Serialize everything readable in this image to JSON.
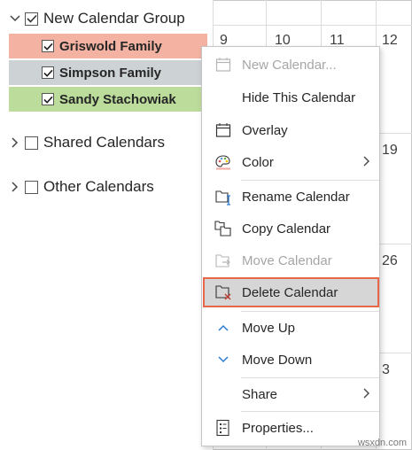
{
  "nav": {
    "group": {
      "label": "New Calendar Group"
    },
    "calendars": [
      {
        "label": "Griswold Family",
        "color": "#f4b3a2"
      },
      {
        "label": "Simpson Family",
        "color": "#cdd2d5"
      },
      {
        "label": "Sandy Stachowiak",
        "color": "#bcdc9c"
      }
    ],
    "shared": {
      "label": "Shared Calendars"
    },
    "other": {
      "label": "Other Calendars"
    }
  },
  "grid": {
    "days": [
      "9",
      "10",
      "11",
      "12",
      "19",
      "26",
      "3"
    ]
  },
  "menu": {
    "items": [
      {
        "label": "New Calendar...",
        "icon": "calendar-icon",
        "disabled": true
      },
      {
        "label": "Hide This Calendar",
        "icon": "",
        "disabled": false
      },
      {
        "label": "Overlay",
        "icon": "overlay-icon",
        "disabled": false
      },
      {
        "label": "Color",
        "icon": "palette-icon",
        "disabled": false,
        "submenu": true
      },
      {
        "label": "Rename Calendar",
        "icon": "rename-icon",
        "disabled": false
      },
      {
        "label": "Copy Calendar",
        "icon": "copy-icon",
        "disabled": false
      },
      {
        "label": "Move Calendar",
        "icon": "move-folder-icon",
        "disabled": true
      },
      {
        "label": "Delete Calendar",
        "icon": "delete-folder-icon",
        "disabled": false,
        "highlighted": true
      },
      {
        "label": "Move Up",
        "icon": "chevron-up-icon",
        "disabled": false
      },
      {
        "label": "Move Down",
        "icon": "chevron-down-icon",
        "disabled": false
      },
      {
        "label": "Share",
        "icon": "",
        "disabled": false,
        "submenu": true
      },
      {
        "label": "Properties...",
        "icon": "properties-icon",
        "disabled": false
      }
    ]
  },
  "highlight_color": "#e8674a",
  "watermark": "wsxdn.com"
}
